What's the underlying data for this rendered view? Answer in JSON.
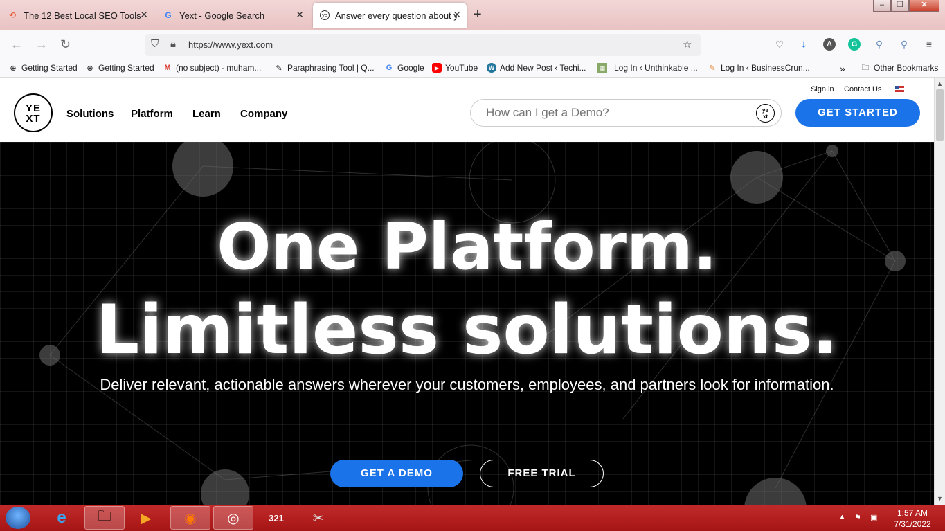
{
  "tabs": [
    {
      "label": "The 12 Best Local SEO Tools",
      "icon": "cycle-icon"
    },
    {
      "label": "Yext - Google Search",
      "icon": "google-icon"
    },
    {
      "label": "Answer every question about ye",
      "icon": "yext-icon",
      "active": true
    }
  ],
  "address": {
    "url": "https://www.yext.com"
  },
  "bookmarks": [
    {
      "label": "Getting Started"
    },
    {
      "label": "Getting Started"
    },
    {
      "label": "(no subject) - muham..."
    },
    {
      "label": "Paraphrasing Tool | Q..."
    },
    {
      "label": "Google"
    },
    {
      "label": "YouTube"
    },
    {
      "label": "Add New Post ‹ Techi..."
    },
    {
      "label": "Log In ‹ Unthinkable ..."
    },
    {
      "label": "Log In ‹ BusinessCrun..."
    },
    {
      "label": "Other Bookmarks"
    }
  ],
  "site": {
    "logo_top": "YE",
    "logo_bottom": "XT",
    "nav": [
      "Solutions",
      "Platform",
      "Learn",
      "Company"
    ],
    "sign_in": "Sign in",
    "contact": "Contact Us",
    "search_placeholder": "How can I get a Demo?",
    "get_started": "GET STARTED"
  },
  "hero": {
    "line1": "One Platform.",
    "line2": "Limitless solutions.",
    "subtitle": "Deliver relevant, actionable answers wherever your customers, employees, and partners look for information.",
    "demo": "GET A DEMO",
    "trial": "FREE TRIAL"
  },
  "taskbar": {
    "time": "1:57 AM",
    "date": "7/31/2022"
  },
  "colors": {
    "brand_blue": "#1a73e8",
    "taskbar": "#b31d1d"
  }
}
